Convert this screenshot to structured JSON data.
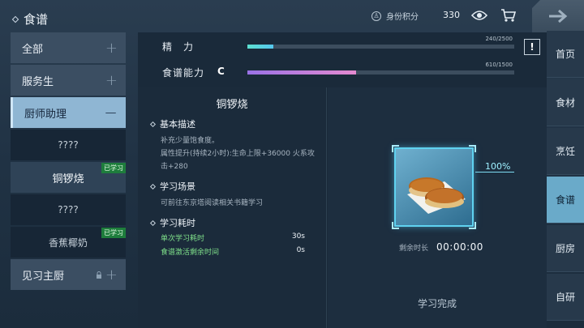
{
  "topbar": {
    "title": "食谱",
    "id_points_label": "身份积分",
    "id_points_value": "330",
    "icons": [
      "eye-icon",
      "cart-icon",
      "back-arrow-icon"
    ]
  },
  "left_menu": {
    "items": [
      {
        "label": "全部"
      },
      {
        "label": "服务生"
      },
      {
        "label": "厨师助理"
      }
    ],
    "sub_items": [
      {
        "label": "????",
        "badge": ""
      },
      {
        "label": "铜锣烧",
        "badge": "已学习"
      },
      {
        "label": "????",
        "badge": ""
      },
      {
        "label": "香蕉椰奶",
        "badge": "已学习"
      }
    ],
    "locked_item": {
      "label": "见习主厨"
    }
  },
  "stats": {
    "energy": {
      "label": "精　力",
      "value_text": "240/2500",
      "fraction": 0.096,
      "color_start": "#5de0d0",
      "color_end": "#55c7ee"
    },
    "recipe": {
      "label": "食谱能力",
      "grade": "C",
      "value_text": "610/1500",
      "fraction": 0.407,
      "color_start": "#9a72e6",
      "color_end": "#e48ad0"
    },
    "warn_label": "!"
  },
  "detail": {
    "title": "铜锣烧",
    "basic_heading": "基本描述",
    "basic_lines": [
      "补充少量饱食度。",
      "属性提升(持续2小时):生命上限+36000 火系攻击+280"
    ],
    "scene_heading": "学习场景",
    "scene_line": "可前往东京塔阅读相关书籍学习",
    "time_heading": "学习耗时",
    "single_time_label": "单次学习耗时",
    "single_time_value": "30s",
    "activate_label": "食谱激活剩余时间",
    "activate_value": "0s"
  },
  "learn": {
    "progress_text": "100%",
    "remain_label": "剩余时长",
    "remain_time": "00:00:00",
    "done_label": "学习完成"
  },
  "right_tabs": [
    {
      "label": "首页"
    },
    {
      "label": "食材"
    },
    {
      "label": "烹饪"
    },
    {
      "label": "食谱"
    },
    {
      "label": "厨房"
    },
    {
      "label": "自研"
    }
  ]
}
